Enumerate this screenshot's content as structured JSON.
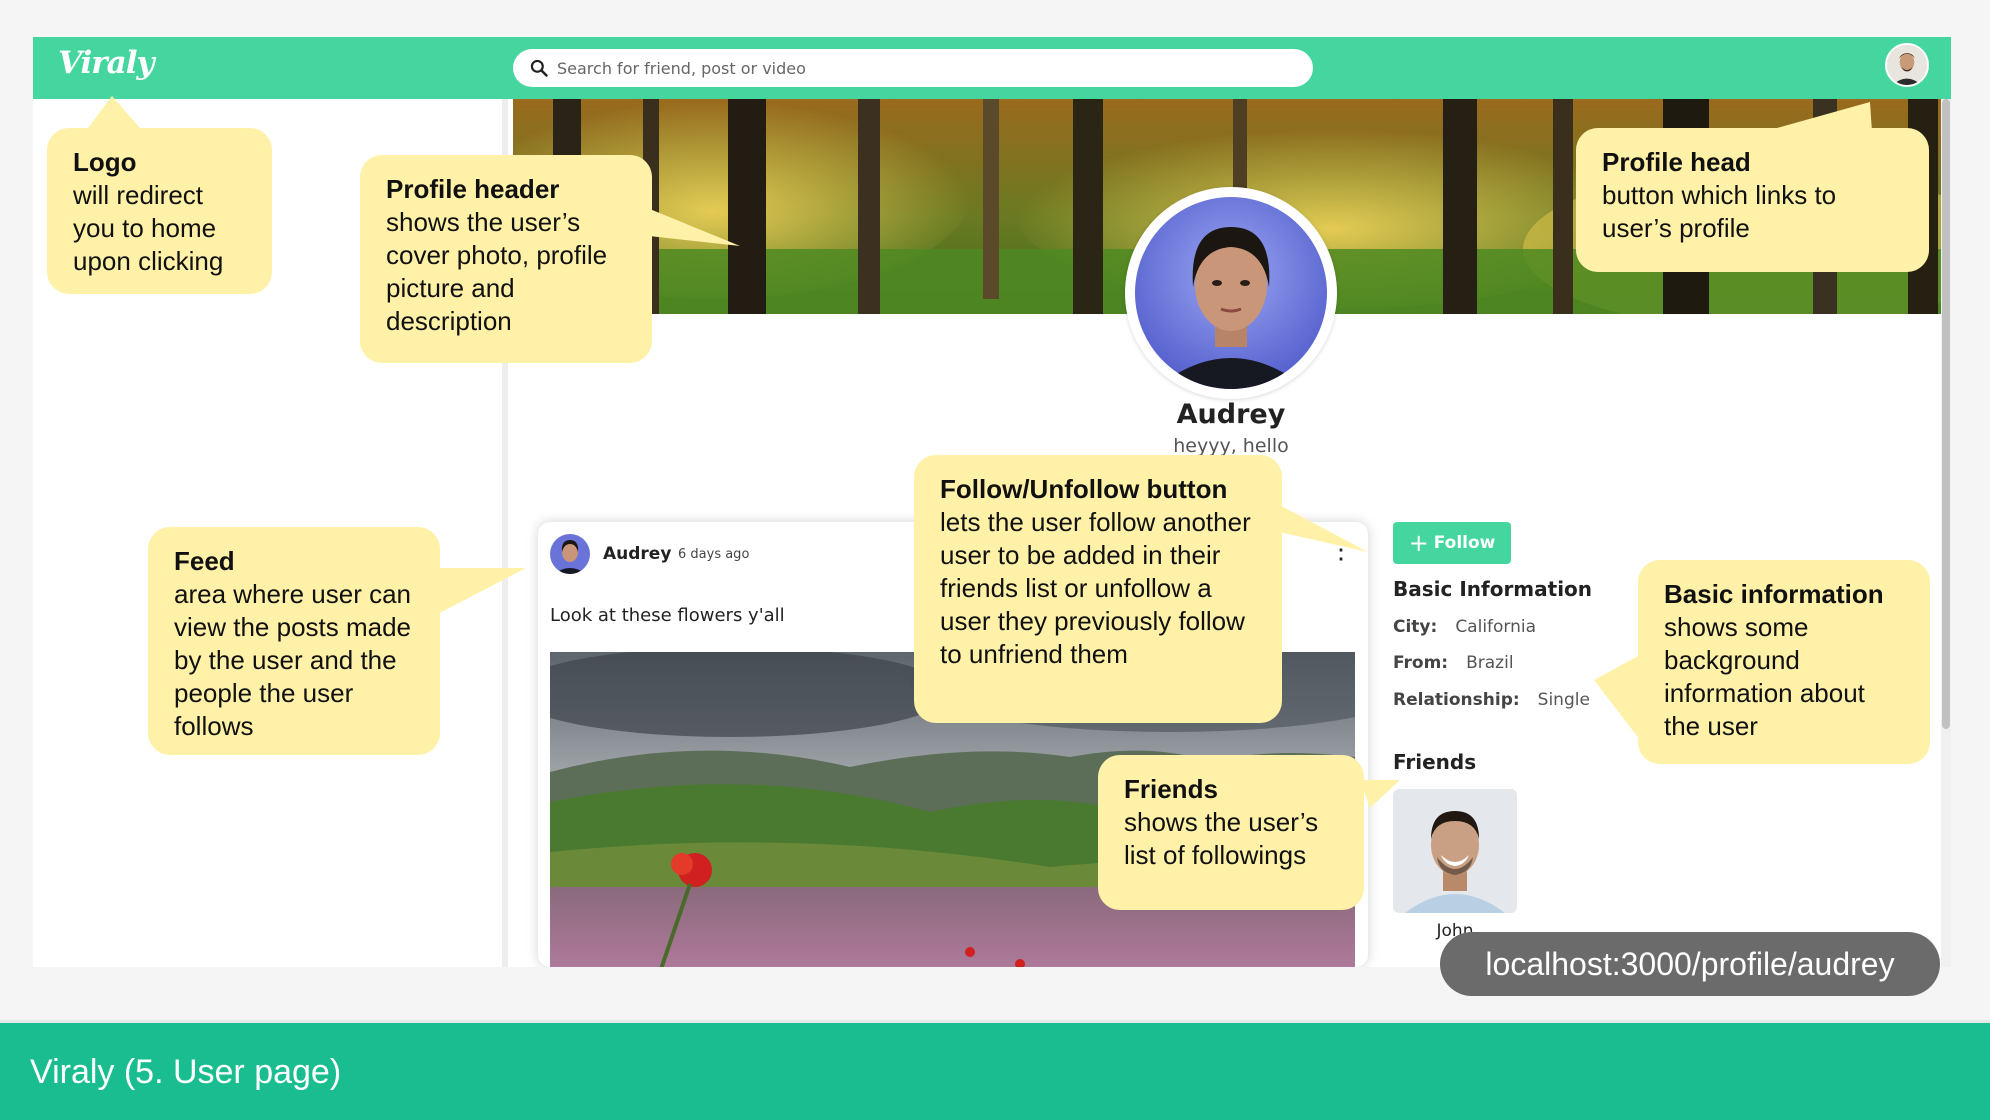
{
  "app": {
    "logo_text": "Viraly",
    "search_placeholder": "Search for friend, post or video"
  },
  "profile": {
    "name": "Audrey",
    "description": "heyyy, hello"
  },
  "post": {
    "user": "Audrey",
    "time": "6 days ago",
    "text": "Look at these flowers y'all",
    "more": "⋮"
  },
  "follow_button": {
    "label": "Follow",
    "icon": "plus-icon"
  },
  "info": {
    "title": "Basic Information",
    "rows": [
      {
        "key": "City:",
        "value": "California"
      },
      {
        "key": "From:",
        "value": "Brazil"
      },
      {
        "key": "Relationship:",
        "value": "Single"
      }
    ]
  },
  "friends": {
    "title": "Friends",
    "items": [
      {
        "name": "John"
      }
    ]
  },
  "callouts": {
    "logo": {
      "title": "Logo",
      "body": "will redirect you to home upon clicking"
    },
    "profile_header": {
      "title": "Profile header",
      "body": "shows the user’s cover photo, profile picture and description"
    },
    "profile_head": {
      "title": "Profile head",
      "body": "button which links to user’s profile"
    },
    "feed": {
      "title": "Feed",
      "body": "area where user can view the posts made by the user and the people the user follows"
    },
    "follow": {
      "title": "Follow/Unfollow button",
      "body": "lets the user follow another user to be added in their friends list  or unfollow a user they previously follow to unfriend them"
    },
    "basic_info": {
      "title": "Basic information",
      "body": "shows some background information about the user"
    },
    "friends": {
      "title": "Friends",
      "body": "shows the user’s list of followings"
    }
  },
  "url": "localhost:3000/profile/audrey",
  "footer": {
    "title": "Viraly (5. User page)"
  },
  "colors": {
    "brand": "#45d6a0",
    "footer": "#1abd90",
    "callout": "#fff2a8",
    "url_pill": "#6b6b6b"
  }
}
